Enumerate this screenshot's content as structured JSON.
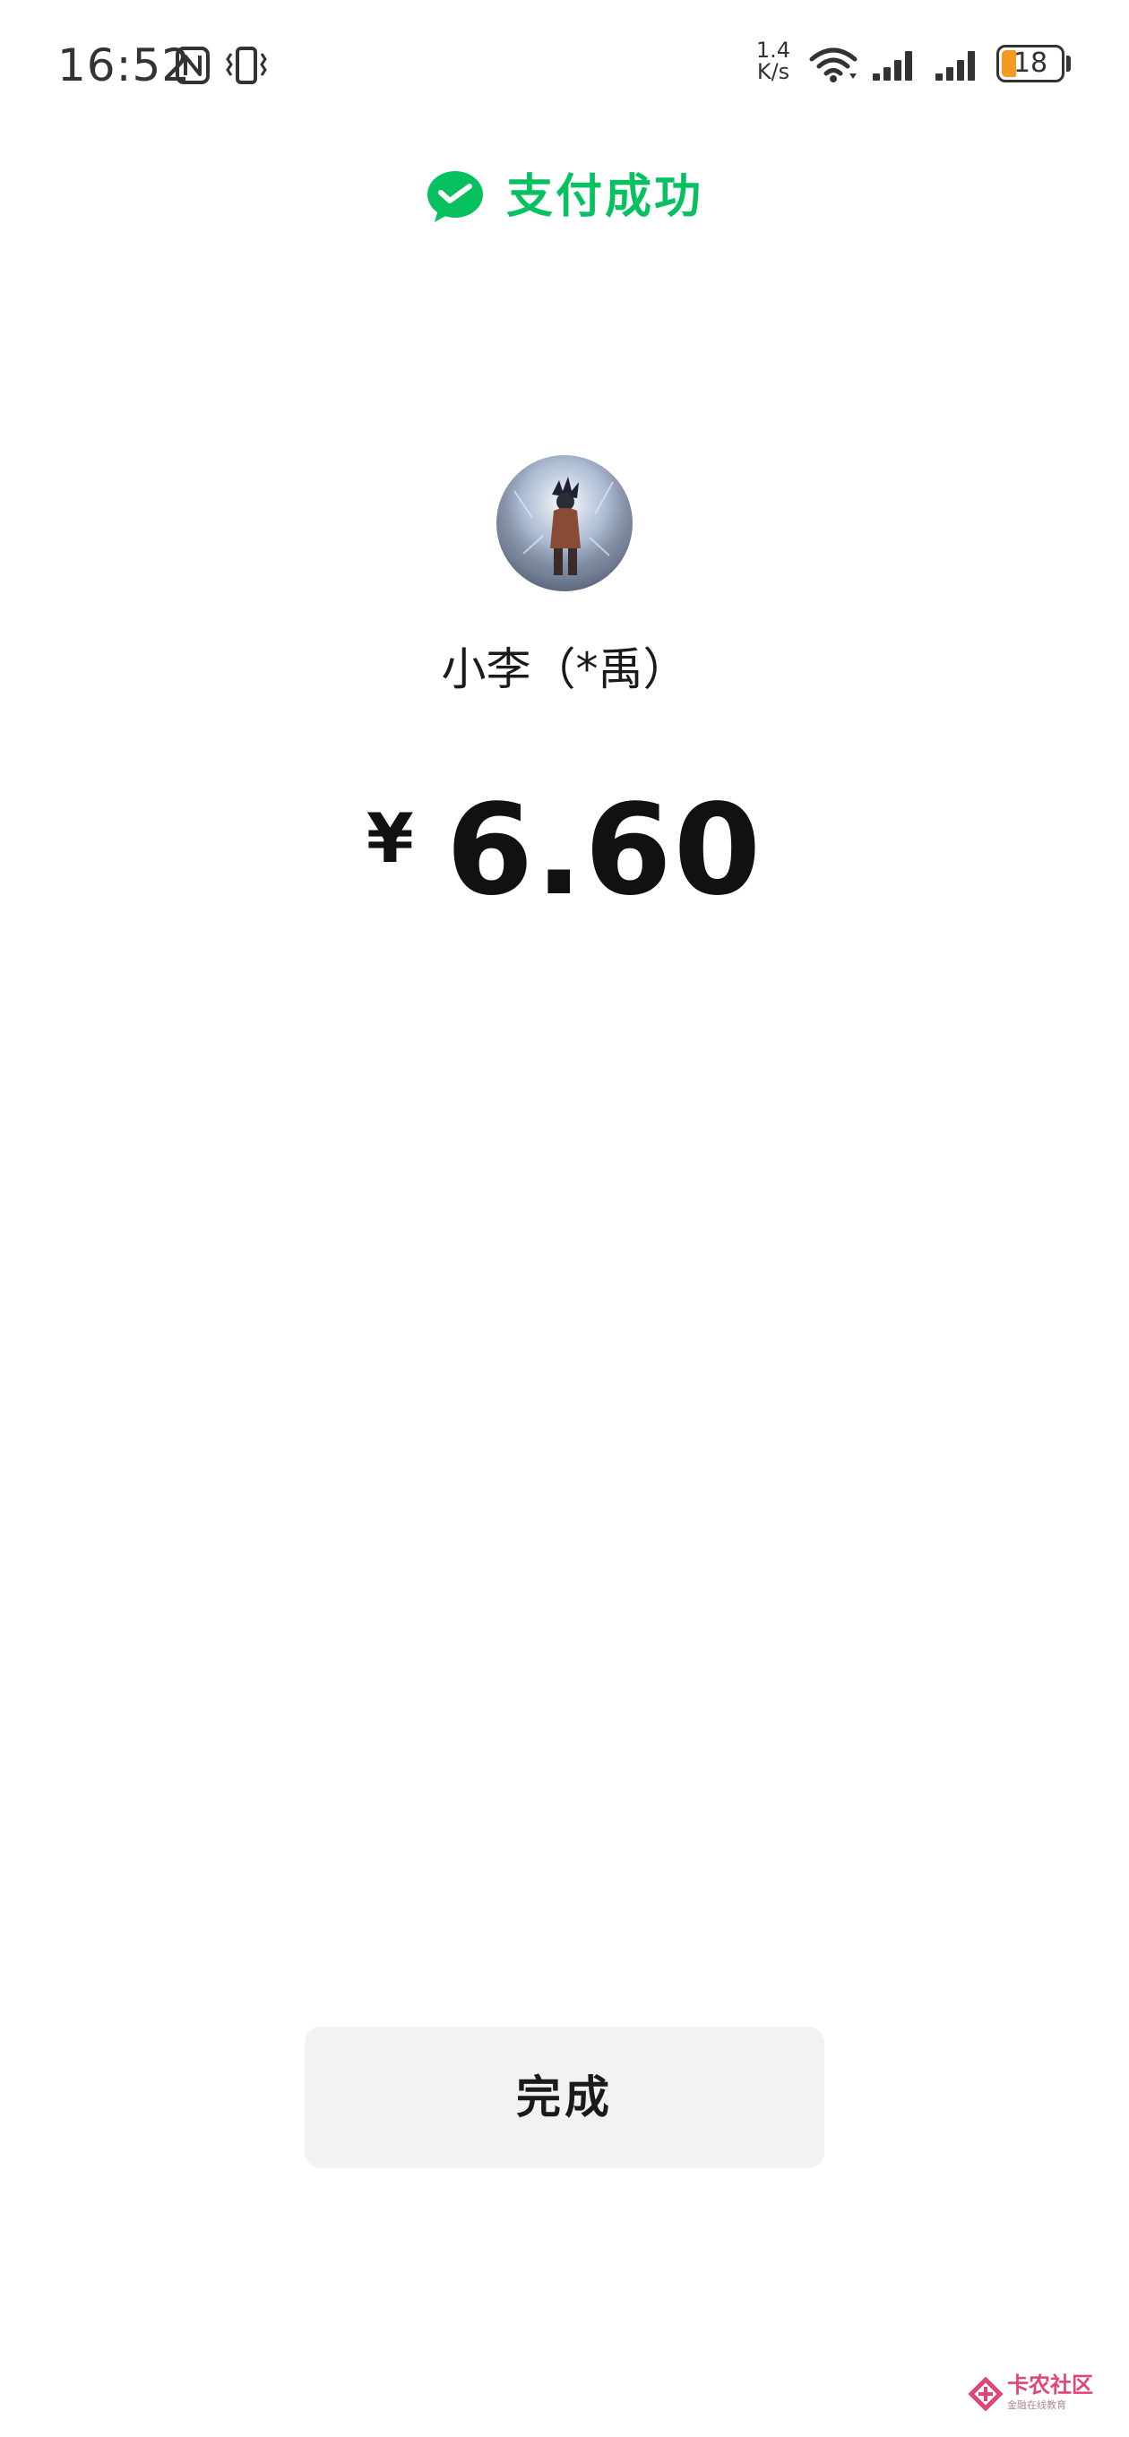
{
  "status_bar": {
    "time": "16:52",
    "net_speed_value": "1.4",
    "net_speed_unit": "K/s",
    "battery_level": "18",
    "battery_color": "#f29a22",
    "icons": [
      "nfc-icon",
      "vibrate-icon",
      "wifi-icon",
      "signal-icon",
      "signal-icon",
      "battery-icon"
    ]
  },
  "header": {
    "title": "支付成功",
    "icon": "wechat-pay-icon",
    "accent_color": "#07c160"
  },
  "payee": {
    "name": "小李（*禹）",
    "avatar": "avatar"
  },
  "amount": {
    "currency": "¥",
    "value": "6.60"
  },
  "actions": {
    "done_label": "完成"
  },
  "watermark": {
    "text": "卡农社区",
    "subtext": "金融在线教育"
  }
}
